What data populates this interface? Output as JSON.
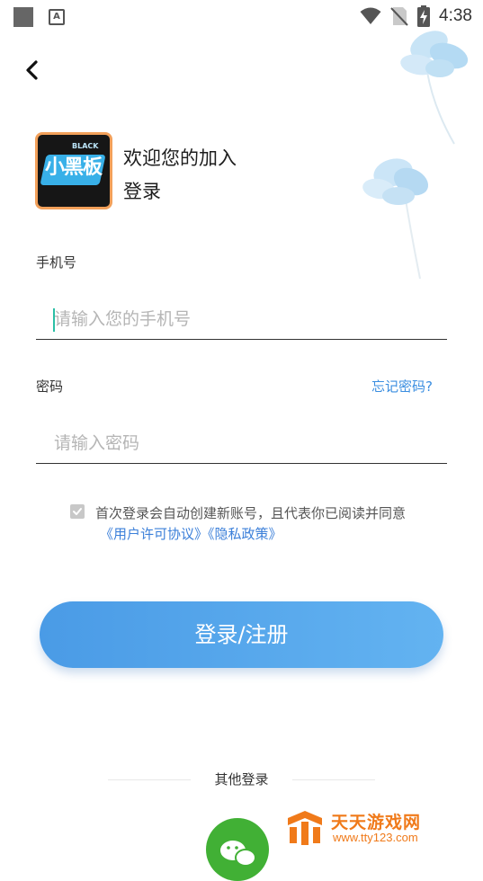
{
  "status_bar": {
    "time": "4:38",
    "notification_letter": "A"
  },
  "header": {
    "welcome": "欢迎您的加入",
    "subtitle": "登录"
  },
  "logo": {
    "text_main": "小黑板",
    "text_small": "BLACK"
  },
  "form": {
    "phone_label": "手机号",
    "phone_placeholder": "请输入您的手机号",
    "password_label": "密码",
    "password_placeholder": "请输入密码",
    "forgot_link": "忘记密码?"
  },
  "agreement": {
    "checked": true,
    "text": "首次登录会自动创建新账号，且代表你已阅读并同意",
    "user_license": "《用户许可协议》",
    "privacy_policy": "《隐私政策》"
  },
  "login_button": "登录/注册",
  "other_login": {
    "label": "其他登录",
    "options": [
      "wechat-icon"
    ]
  },
  "watermark": {
    "title": "天天游戏网",
    "url": "www.tty123.com"
  },
  "colors": {
    "accent": "#4a9be6",
    "link": "#3b8ee0",
    "caret": "#2bbfa6",
    "wechat": "#41b035",
    "watermark": "#f07a1a"
  }
}
